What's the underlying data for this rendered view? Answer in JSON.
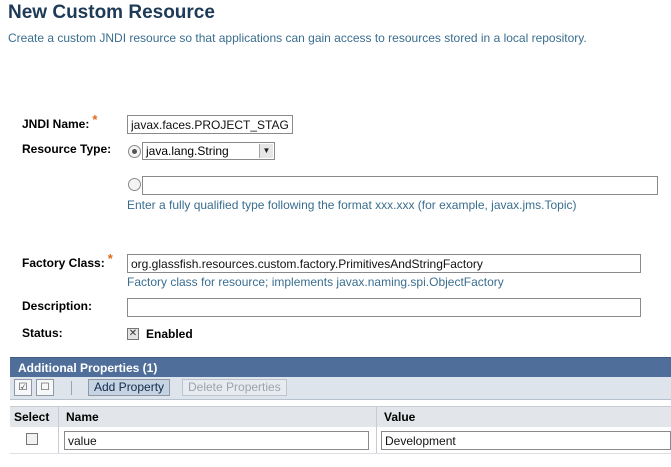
{
  "page": {
    "title": "New Custom Resource",
    "description": "Create a custom JNDI resource so that applications can gain access to resources stored in a local repository."
  },
  "form": {
    "jndi_name": {
      "label": "JNDI Name:",
      "required_marker": "*",
      "value": "javax.faces.PROJECT_STAGE"
    },
    "resource_type": {
      "label": "Resource Type:",
      "selected_option": "java.lang.String",
      "custom_value": "",
      "help": "Enter a fully qualified type following the format xxx.xxx (for example, javax.jms.Topic)"
    },
    "factory_class": {
      "label": "Factory Class:",
      "required_marker": "*",
      "value": "org.glassfish.resources.custom.factory.PrimitivesAndStringFactory",
      "help": "Factory class for resource; implements javax.naming.spi.ObjectFactory"
    },
    "description": {
      "label": "Description:",
      "value": ""
    },
    "status": {
      "label": "Status:",
      "checkbox_label": "Enabled",
      "checked": true
    }
  },
  "properties": {
    "title": "Additional Properties (1)",
    "toolbar": {
      "add_label": "Add Property",
      "delete_label": "Delete Properties"
    },
    "columns": [
      "Select",
      "Name",
      "Value"
    ],
    "rows": [
      {
        "name": "value",
        "value": "Development"
      }
    ]
  },
  "colors": {
    "title": "#1d3a57",
    "help_text": "#3a6e8f",
    "required": "#e06a1a",
    "table_header": "#4f6f9a"
  },
  "icons": {
    "select_all": "select-all-icon",
    "deselect_all": "deselect-all-icon",
    "dropdown": "chevron-down-icon",
    "check": "checkmark-icon"
  }
}
